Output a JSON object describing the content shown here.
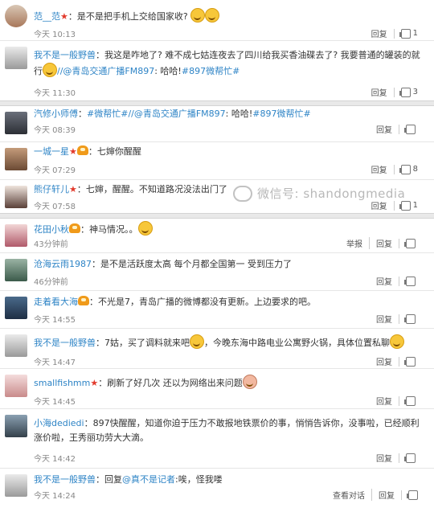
{
  "actions": {
    "reply": "回复",
    "report": "举报",
    "view_conversation": "查看对话"
  },
  "watermark": "微信号: shandongmedia",
  "comments": [
    {
      "user": "范__范",
      "text": "：是不是把手机上交给国家收?",
      "time": "今天 10:13",
      "likes": "1"
    },
    {
      "user": "我不是一般野兽",
      "text": "：我这是咋地了? 难不成七姑连夜去了四川给我买香油碟去了? 我要普通的罐装的就行",
      "mention": "//@青岛交通广播FM897",
      "text2": ": 哈哈!",
      "tag": "#897微帮忙#",
      "time": "今天 11:30",
      "likes": "3"
    },
    {
      "user": "汽修小师傅",
      "tag": "#微帮忙#",
      "mention": "//@青岛交通广播FM897",
      "text2": ": 哈哈!",
      "tag2": "#897微帮忙#",
      "time": "今天 08:39",
      "likes": ""
    },
    {
      "user": "一城一星",
      "text": "：七婶你醒醒",
      "time": "今天 07:29",
      "likes": "8"
    },
    {
      "user": "熊仔轩儿",
      "text": "：七婶，醒醒。不知道路况没法出门了",
      "time": "今天 07:58",
      "likes": "1"
    },
    {
      "user": "花田小秋",
      "text": "：神马情况。。",
      "time": "43分钟前",
      "likes": ""
    },
    {
      "user": "沧海云雨1987",
      "text": "：是不是活跃度太高 每个月都全国第一 受到压力了",
      "time": "46分钟前",
      "likes": ""
    },
    {
      "user": "走着看大海",
      "text": "：不光是7，青岛广播的微博都没有更新。上边要求的吧。",
      "time": "今天 14:55",
      "likes": ""
    },
    {
      "user": "我不是一般野兽",
      "text": "：7姑，买了调料就来吧",
      "text2": "，今晚东海中路电业公寓野火锅，具体位置私聊",
      "time": "今天 14:47",
      "likes": ""
    },
    {
      "user": "smallfishmm",
      "text": "：刷新了好几次 还以为网络出来问题",
      "time": "今天 14:45",
      "likes": ""
    },
    {
      "user": "小海dediedi",
      "text": "：897快醒醒，知道你迫于压力不敢报地铁票价的事，悄悄告诉你，没事啦，已经顺利涨价啦，王秀丽功劳大大滴。",
      "time": "今天 14:42",
      "likes": ""
    },
    {
      "user": "我不是一般野兽",
      "text": "：回复",
      "mention": "@真不是记者",
      "text2": ":唉，怪我喽",
      "time": "今天 14:24",
      "likes": ""
    }
  ]
}
